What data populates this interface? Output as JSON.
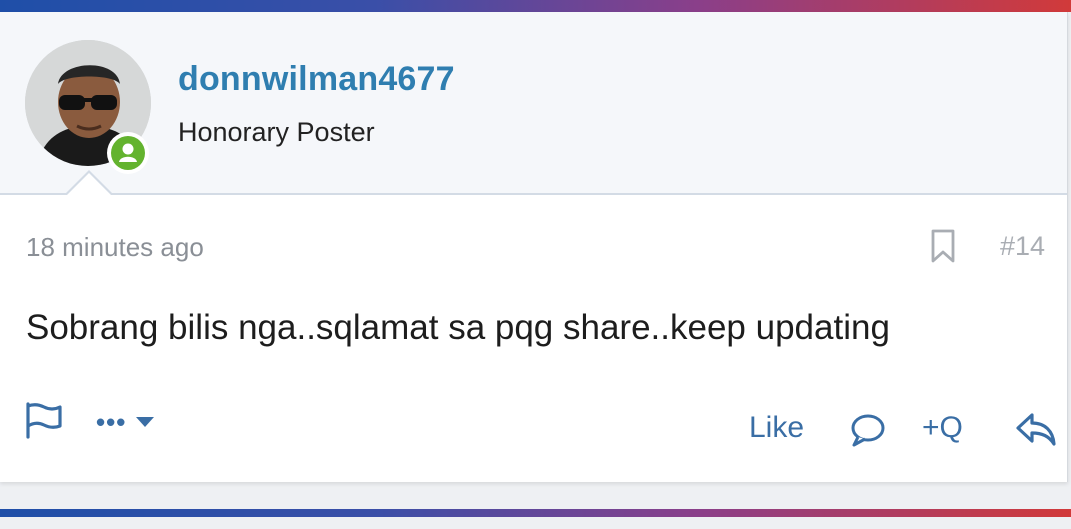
{
  "user": {
    "username": "donnwilman4677",
    "title": "Honorary Poster",
    "online": true
  },
  "post": {
    "timestamp": "18 minutes ago",
    "number": "#14",
    "message": "Sobrang bilis nga..sqlamat sa pqg share..keep updating"
  },
  "actions": {
    "like_label": "Like",
    "quote_label": "+Q",
    "more_label": "•••"
  },
  "icons": {
    "report": "flag-icon",
    "bookmark": "bookmark-icon",
    "more": "chevron-down-icon",
    "comment": "comment-icon",
    "reply": "reply-icon",
    "online": "user-online-icon"
  },
  "colors": {
    "link": "#2f7eb0",
    "action": "#3a6ea5",
    "online": "#63b32e"
  }
}
